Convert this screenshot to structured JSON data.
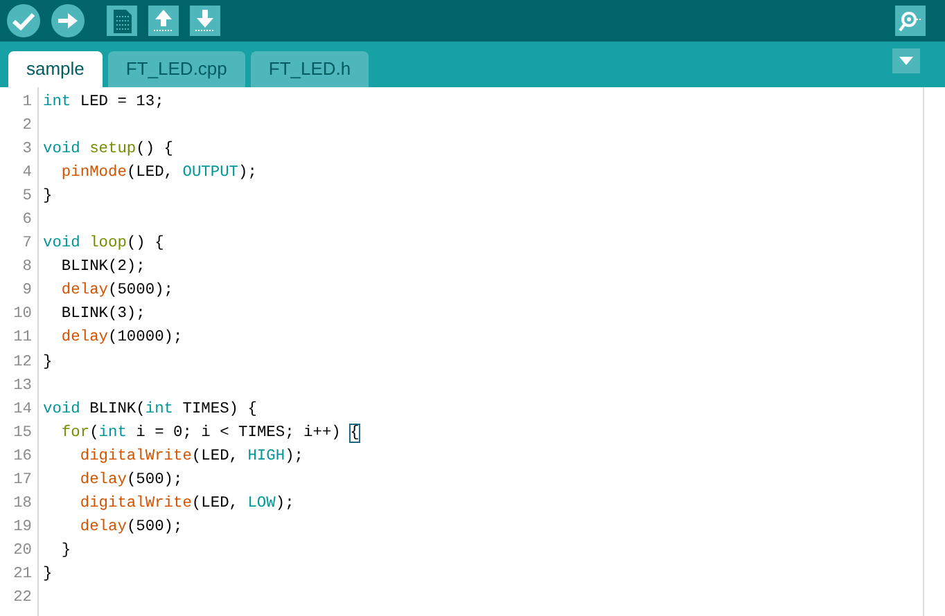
{
  "toolbar": {
    "buttons": [
      {
        "kind": "verify"
      },
      {
        "kind": "upload"
      },
      {
        "kind": "new"
      },
      {
        "kind": "open"
      },
      {
        "kind": "save"
      }
    ],
    "right_button": {
      "kind": "serial-monitor"
    }
  },
  "tabs": [
    {
      "label": "sample",
      "selected": true
    },
    {
      "label": "FT_LED.cpp",
      "selected": false
    },
    {
      "label": "FT_LED.h",
      "selected": false
    }
  ],
  "editor": {
    "lines": [
      {
        "number": "1",
        "tokens": [
          {
            "text": "int",
            "kind": "type"
          },
          {
            "text": " LED = 13;",
            "kind": "plain"
          }
        ]
      },
      {
        "number": "2"
      },
      {
        "number": "3",
        "tokens": [
          {
            "text": "void ",
            "kind": "type"
          },
          {
            "text": "setup",
            "kind": "ctrl"
          },
          {
            "text": "() {",
            "kind": "plain"
          }
        ]
      },
      {
        "number": "4",
        "tokens": [
          {
            "text": "  pinMode",
            "kind": "func"
          },
          {
            "text": "(LED, ",
            "kind": "plain"
          },
          {
            "text": "OUTPUT",
            "kind": "const"
          },
          {
            "text": ");",
            "kind": "plain"
          }
        ]
      },
      {
        "number": "5",
        "tokens": [
          {
            "text": "}",
            "kind": "plain"
          }
        ]
      },
      {
        "number": "6"
      },
      {
        "number": "7",
        "tokens": [
          {
            "text": "void ",
            "kind": "type"
          },
          {
            "text": "loop",
            "kind": "ctrl"
          },
          {
            "text": "() {",
            "kind": "plain"
          }
        ]
      },
      {
        "number": "8",
        "tokens": [
          {
            "text": "  BLINK(2);",
            "kind": "plain"
          }
        ]
      },
      {
        "number": "9",
        "tokens": [
          {
            "text": "  delay",
            "kind": "func"
          },
          {
            "text": "(5000);",
            "kind": "plain"
          }
        ]
      },
      {
        "number": "10",
        "tokens": [
          {
            "text": "  BLINK(3);",
            "kind": "plain"
          }
        ]
      },
      {
        "number": "11",
        "tokens": [
          {
            "text": "  delay",
            "kind": "func"
          },
          {
            "text": "(10000);",
            "kind": "plain"
          }
        ]
      },
      {
        "number": "12",
        "tokens": [
          {
            "text": "}",
            "kind": "plain"
          }
        ]
      },
      {
        "number": "13"
      },
      {
        "number": "14",
        "tokens": [
          {
            "text": "void",
            "kind": "type"
          },
          {
            "text": " BLINK(",
            "kind": "plain"
          },
          {
            "text": "int",
            "kind": "type"
          },
          {
            "text": " TIMES) {",
            "kind": "plain"
          }
        ]
      },
      {
        "number": "15",
        "tokens": [
          {
            "text": "  for",
            "kind": "ctrl"
          },
          {
            "text": "(",
            "kind": "plain"
          },
          {
            "text": "int",
            "kind": "type"
          },
          {
            "text": " i = 0; i < TIMES; i++) ",
            "kind": "plain"
          },
          {
            "text": "{",
            "kind": "match"
          }
        ]
      },
      {
        "number": "16",
        "tokens": [
          {
            "text": "    digitalWrite",
            "kind": "func"
          },
          {
            "text": "(LED, ",
            "kind": "plain"
          },
          {
            "text": "HIGH",
            "kind": "const"
          },
          {
            "text": ");",
            "kind": "plain"
          }
        ]
      },
      {
        "number": "17",
        "tokens": [
          {
            "text": "    delay",
            "kind": "func"
          },
          {
            "text": "(500);",
            "kind": "plain"
          }
        ]
      },
      {
        "number": "18",
        "tokens": [
          {
            "text": "    digitalWrite",
            "kind": "func"
          },
          {
            "text": "(LED, ",
            "kind": "plain"
          },
          {
            "text": "LOW",
            "kind": "const"
          },
          {
            "text": ");",
            "kind": "plain"
          }
        ]
      },
      {
        "number": "19",
        "tokens": [
          {
            "text": "    delay",
            "kind": "func"
          },
          {
            "text": "(500);",
            "kind": "plain"
          }
        ]
      },
      {
        "number": "20",
        "tokens": [
          {
            "text": "  }",
            "kind": "plain"
          }
        ]
      },
      {
        "number": "21",
        "tokens": [
          {
            "text": "}",
            "kind": "plain"
          }
        ]
      },
      {
        "number": "22"
      }
    ]
  }
}
